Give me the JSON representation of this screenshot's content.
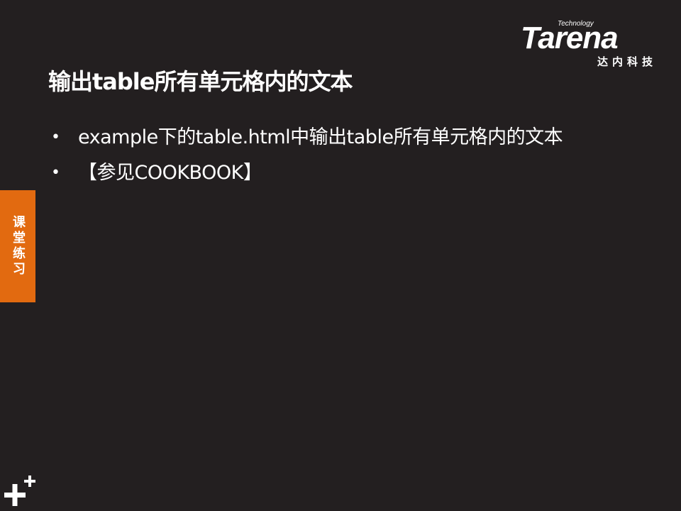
{
  "logo": {
    "technology": "Technology",
    "wordmark": "Tarena",
    "chinese": "达内科技"
  },
  "slide": {
    "title": "输出table所有单元格内的文本",
    "bullets": [
      "example下的table.html中输出table所有单元格内的文本",
      "【参见COOKBOOK】"
    ]
  },
  "side_tab": {
    "label": "课堂练习",
    "color": "#e26a10"
  },
  "theme": {
    "background": "#231f20",
    "text": "#ffffff"
  },
  "icons": {
    "corner": "plus-plus-icon"
  }
}
